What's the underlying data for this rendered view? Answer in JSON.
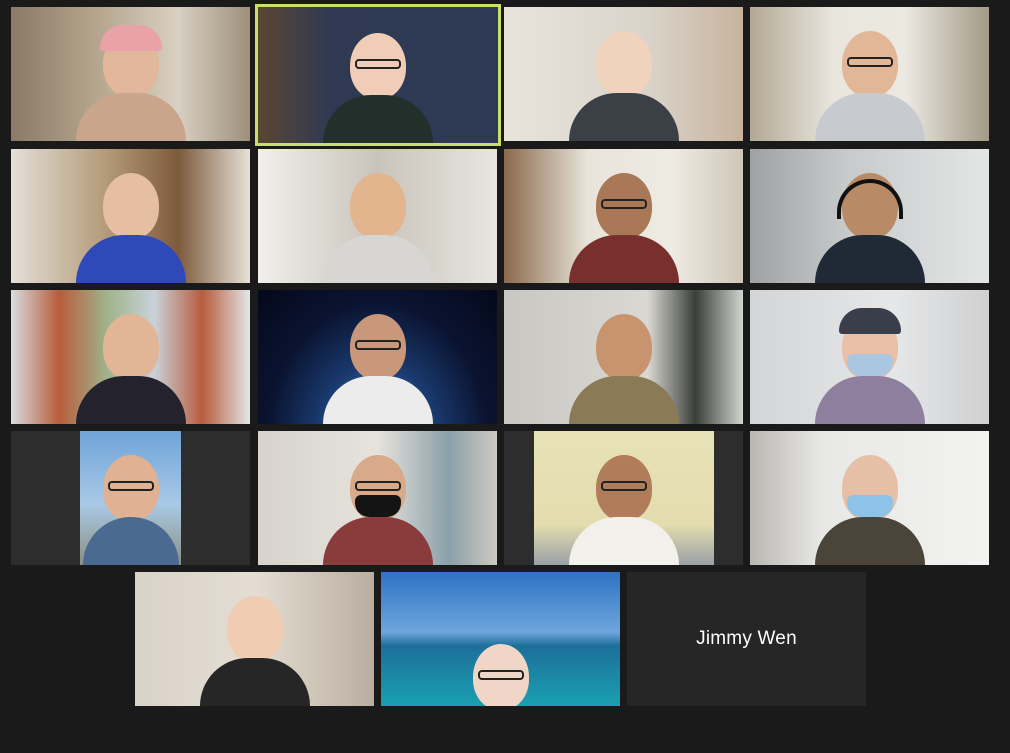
{
  "window": {
    "view": "gallery",
    "accent_speaking": "#c8e06a",
    "background": "#1a1a1a"
  },
  "participants": [
    {
      "video": "on",
      "speaking": false,
      "scene": "living-room"
    },
    {
      "video": "on",
      "speaking": true,
      "scene": "world-map-wall"
    },
    {
      "video": "on",
      "speaking": false,
      "scene": "bedroom-wall"
    },
    {
      "video": "on",
      "speaking": false,
      "scene": "room-with-ceiling-fan"
    },
    {
      "video": "on",
      "speaking": false,
      "scene": "hallway"
    },
    {
      "video": "on",
      "speaking": false,
      "scene": "apartment-room"
    },
    {
      "video": "on",
      "speaking": false,
      "scene": "office-desk"
    },
    {
      "video": "on",
      "speaking": false,
      "scene": "blurred-room-headset"
    },
    {
      "video": "on",
      "speaking": false,
      "scene": "outdoor-columns"
    },
    {
      "video": "on",
      "speaking": false,
      "scene": "earth-from-space"
    },
    {
      "video": "on",
      "speaking": false,
      "scene": "room-with-plant"
    },
    {
      "video": "on",
      "speaking": false,
      "scene": "white-room-mask"
    },
    {
      "video": "on",
      "speaking": false,
      "scene": "outdoor-sky-portrait"
    },
    {
      "video": "on",
      "speaking": false,
      "scene": "room-mask"
    },
    {
      "video": "on",
      "speaking": false,
      "scene": "yellow-wall"
    },
    {
      "video": "on",
      "speaking": false,
      "scene": "white-office-mask"
    },
    {
      "video": "on",
      "speaking": false,
      "scene": "bedroom-posters"
    },
    {
      "video": "on",
      "speaking": false,
      "scene": "tropical-ocean"
    },
    {
      "video": "off",
      "speaking": false,
      "name": "Jimmy Wen"
    }
  ]
}
